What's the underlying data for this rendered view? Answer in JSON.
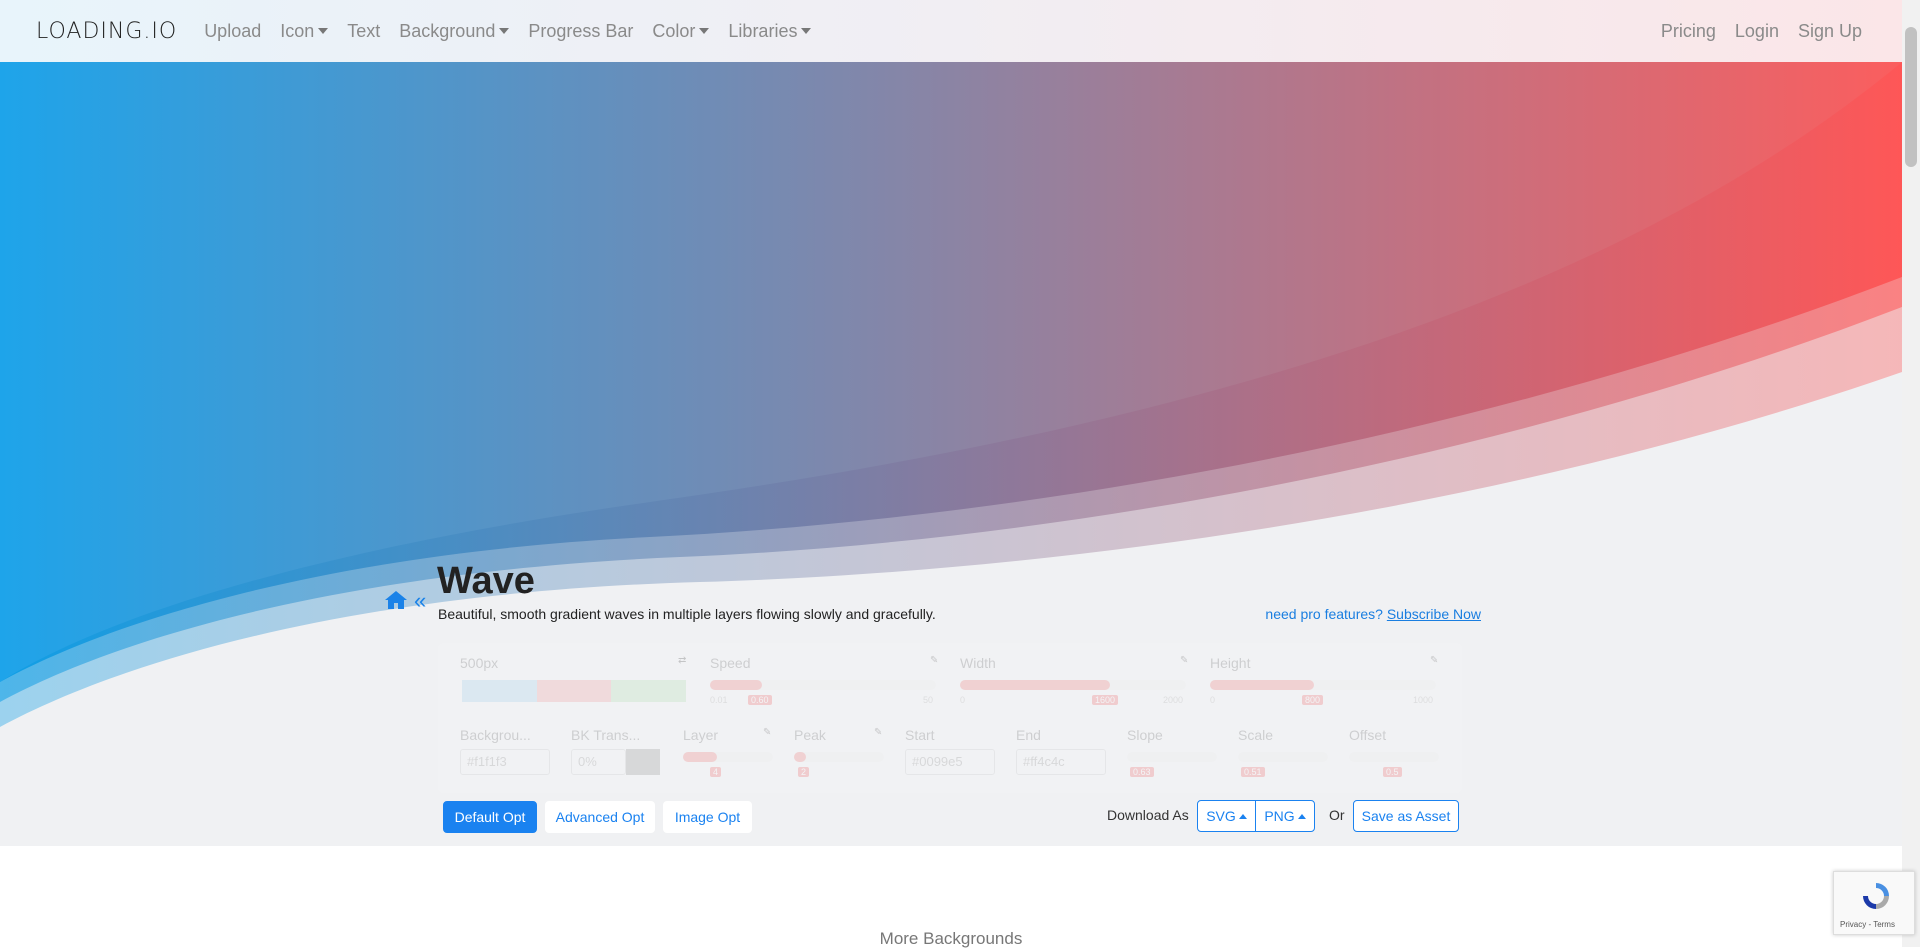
{
  "navbar": {
    "brand": "LOADING.IO",
    "left_items": [
      {
        "label": "Upload",
        "dropdown": false
      },
      {
        "label": "Icon",
        "dropdown": true
      },
      {
        "label": "Text",
        "dropdown": false
      },
      {
        "label": "Background",
        "dropdown": true
      },
      {
        "label": "Progress Bar",
        "dropdown": false
      },
      {
        "label": "Color",
        "dropdown": true
      },
      {
        "label": "Libraries",
        "dropdown": true
      }
    ],
    "right_items": [
      "Pricing",
      "Login",
      "Sign Up"
    ]
  },
  "hero": {
    "title": "Wave",
    "subtitle": "Beautiful, smooth gradient waves in multiple layers flowing slowly and gracefully.",
    "pro_text": "need pro features?",
    "pro_link": "Subscribe Now",
    "colors": {
      "start": "#0099e5",
      "end": "#ff4c4c",
      "background": "#f1f1f3"
    }
  },
  "options": {
    "size": "500px",
    "speed": {
      "label": "Speed",
      "value": "0.60",
      "min": "0.01",
      "max": "50"
    },
    "width": {
      "label": "Width",
      "value": "1600",
      "min": "0",
      "max": "2000"
    },
    "height": {
      "label": "Height",
      "value": "800",
      "min": "0",
      "max": "1000"
    },
    "background": {
      "label": "Backgrou...",
      "value": "#f1f1f3"
    },
    "bk_trans": {
      "label": "BK Trans...",
      "value": "0%"
    },
    "layer": {
      "label": "Layer",
      "value": "4",
      "min": "0",
      "max": "50"
    },
    "peak": {
      "label": "Peak",
      "value": "2",
      "min": "0",
      "max": "50"
    },
    "start": {
      "label": "Start",
      "value": "#0099e5"
    },
    "end": {
      "label": "End",
      "value": "#ff4c4c"
    },
    "slope": {
      "label": "Slope",
      "value": "0.63",
      "min": "0",
      "max": "5"
    },
    "scale": {
      "label": "Scale",
      "value": "0.51",
      "min": "0",
      "max": "5"
    },
    "offset": {
      "label": "Offset",
      "value": "0.5",
      "min": "0",
      "max": "1"
    }
  },
  "buttons": {
    "default_opt": "Default Opt",
    "advanced_opt": "Advanced Opt",
    "image_opt": "Image Opt",
    "download_as": "Download As",
    "svg": "SVG",
    "png": "PNG",
    "or": "Or",
    "save_asset": "Save as Asset"
  },
  "more_backgrounds": "More Backgrounds",
  "recaptcha": {
    "footer": "Privacy - Terms"
  }
}
